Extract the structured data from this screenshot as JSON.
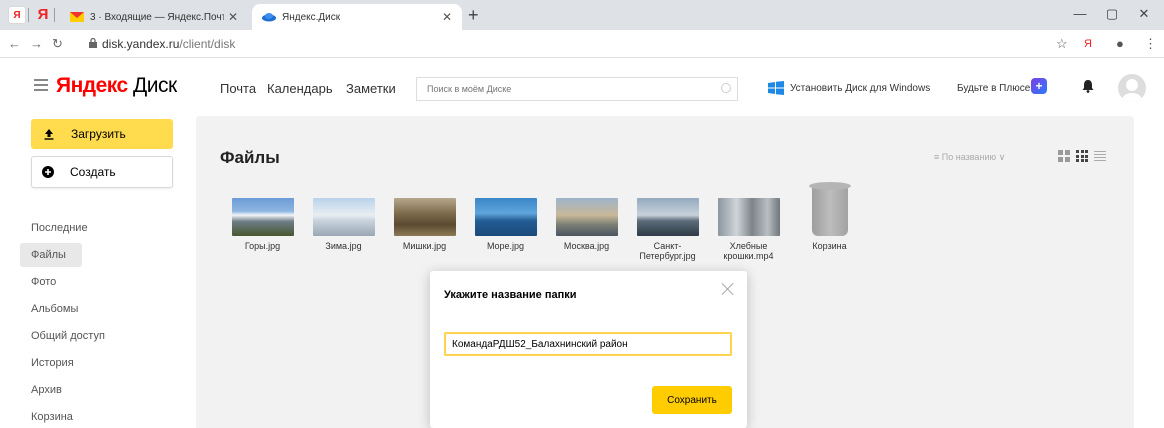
{
  "browser": {
    "pinned_tab_1": "Я",
    "pinned_tab_2": "Я",
    "tabs": [
      {
        "title": "3 · Входящие — Яндекс.Почта",
        "close": "✕"
      },
      {
        "title": "Яндекс.Диск",
        "close": "✕"
      }
    ],
    "new_tab": "+",
    "url_host": "disk.yandex.ru",
    "url_path": "/client/disk"
  },
  "header": {
    "logo_brand": "Яндекс",
    "logo_product": "Диск",
    "nav": [
      "Почта",
      "Календарь",
      "Заметки"
    ],
    "search_placeholder": "Поиск в моём Диске",
    "install_label": "Установить Диск для Windows",
    "plus_label": "Будьте в Плюсе",
    "plus_badge": "+"
  },
  "sidebar": {
    "upload_label": "Загрузить",
    "create_label": "Создать",
    "items": [
      "Последние",
      "Файлы",
      "Фото",
      "Альбомы",
      "Общий доступ",
      "История",
      "Архив",
      "Корзина"
    ],
    "active_item": "Файлы"
  },
  "main": {
    "title": "Файлы",
    "sort_label": "По названию",
    "files": [
      {
        "name": "Горы.jpg",
        "thumb": "gory"
      },
      {
        "name": "Зима.jpg",
        "thumb": "zima"
      },
      {
        "name": "Мишки.jpg",
        "thumb": "mishki"
      },
      {
        "name": "Море.jpg",
        "thumb": "more"
      },
      {
        "name": "Москва.jpg",
        "thumb": "moskva"
      },
      {
        "name": "Санкт-Петербург.jpg",
        "thumb": "spb"
      },
      {
        "name": "Хлебные крошки.mp4",
        "thumb": "krosh"
      },
      {
        "name": "Корзина",
        "thumb": "trash"
      }
    ]
  },
  "dialog": {
    "title": "Укажите название папки",
    "input_value": "КомандаРДШ52_Балахнинский район",
    "save_label": "Сохранить"
  },
  "colors": {
    "accent_yellow": "#ffdb4d",
    "save_yellow": "#ffcc00",
    "brand_red": "#ff0000"
  }
}
